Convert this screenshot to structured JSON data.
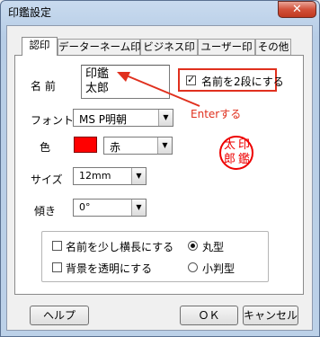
{
  "window": {
    "title": "印鑑設定",
    "close_glyph": "✕"
  },
  "tabs": [
    {
      "label": "認印"
    },
    {
      "label": "データーネーム印"
    },
    {
      "label": "ビジネス印"
    },
    {
      "label": "ユーザー印"
    },
    {
      "label": "その他"
    }
  ],
  "form": {
    "name_label": "名 前",
    "name_line1": "印鑑",
    "name_line2": "太郎",
    "two_line_checkbox_label": "名前を2段にする",
    "two_line_checked": true,
    "font_label": "フォント",
    "font_value": "MS P明朝",
    "color_label": "色",
    "color_value": "赤",
    "color_swatch": "#ff0000",
    "size_label": "サイズ",
    "size_value": "12mm",
    "tilt_label": "傾き",
    "tilt_value": "0°"
  },
  "annotation": {
    "text": "Enterする",
    "color": "#e0301e"
  },
  "preview": {
    "chars": [
      "太",
      "印",
      "郎",
      "鑑"
    ],
    "color": "#e00000"
  },
  "options": {
    "wide_checkbox_label": "名前を少し横長にする",
    "wide_checked": false,
    "transparent_checkbox_label": "背景を透明にする",
    "transparent_checked": false,
    "round_radio_label": "丸型",
    "round_selected": true,
    "oval_radio_label": "小判型",
    "oval_selected": false
  },
  "buttons": {
    "help": "ヘルプ",
    "ok": "ＯＫ",
    "cancel": "キャンセル"
  }
}
